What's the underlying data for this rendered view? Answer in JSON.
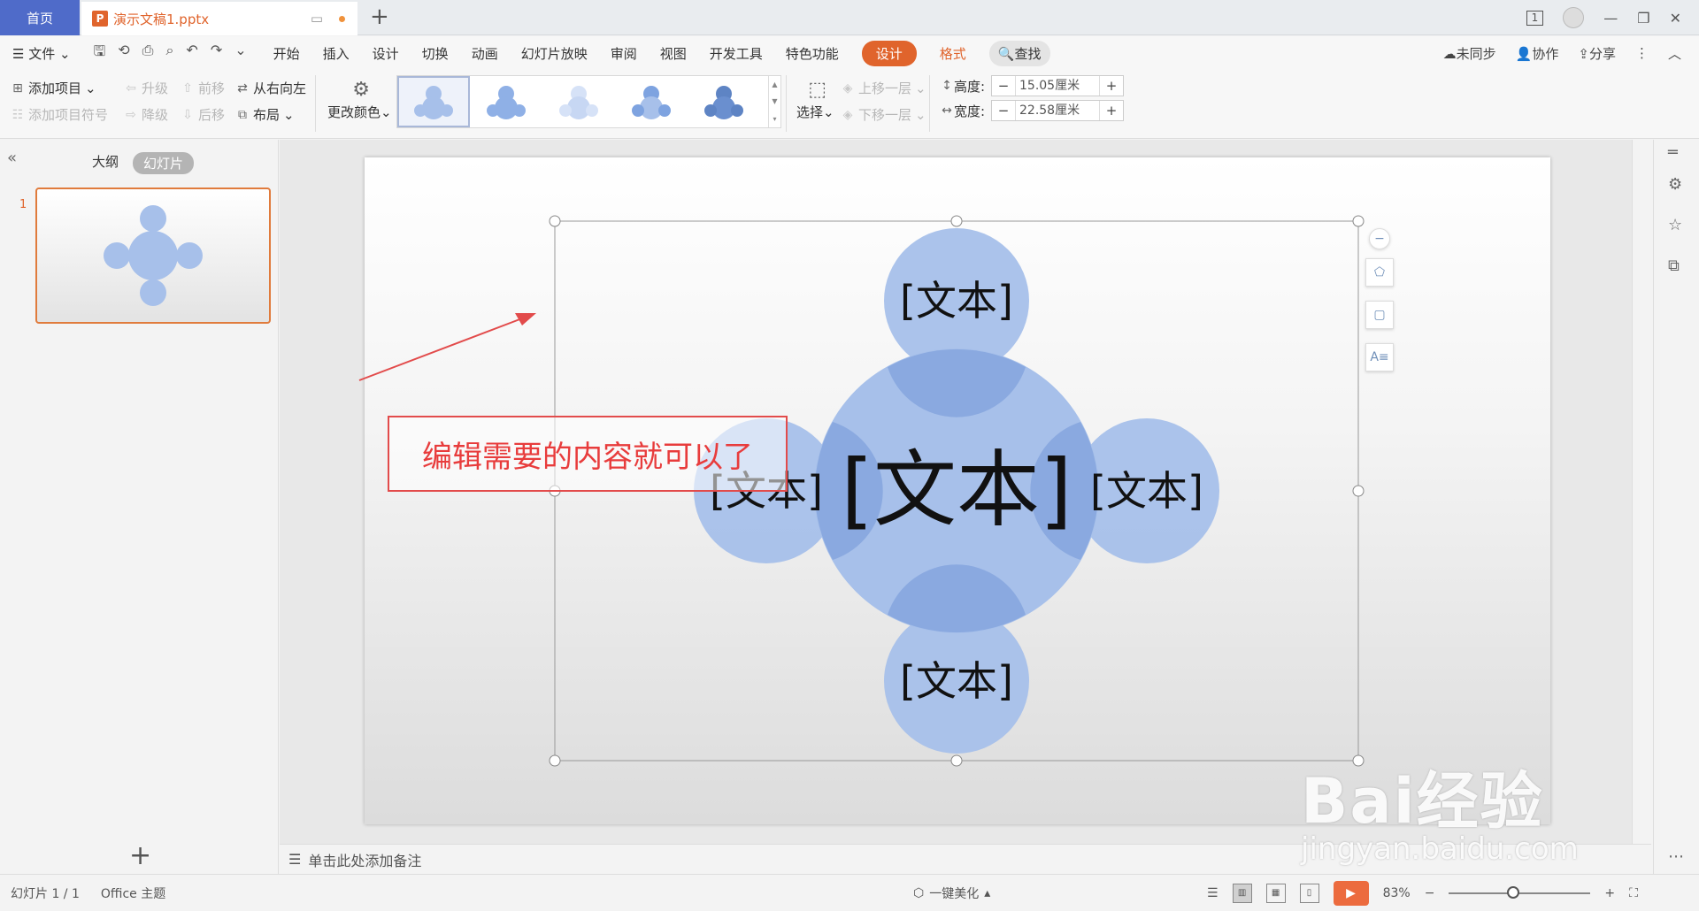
{
  "titlebar": {
    "home_tab": "首页",
    "doc_tab": "演示文稿1.pptx",
    "doc_icon": "P",
    "add_tab": "+",
    "page_indicator": "1"
  },
  "menubar": {
    "file": "文件",
    "items": [
      "开始",
      "插入",
      "设计",
      "切换",
      "动画",
      "幻灯片放映",
      "审阅",
      "视图",
      "开发工具",
      "特色功能"
    ],
    "design_active": "设计",
    "format": "格式",
    "search": "查找",
    "sync": "未同步",
    "collab": "协作",
    "share": "分享"
  },
  "ribbon": {
    "add_item": "添加项目",
    "add_bullet": "添加项目符号",
    "promote": "升级",
    "demote": "降级",
    "move_up": "前移",
    "move_down": "后移",
    "right_to_left": "从右向左",
    "layout": "布局",
    "change_colors": "更改颜色",
    "select": "选择",
    "bring_forward": "上移一层",
    "send_backward": "下移一层",
    "height_label": "高度:",
    "height_value": "15.05厘米",
    "width_label": "宽度:",
    "width_value": "22.58厘米"
  },
  "leftpanel": {
    "outline_tab": "大纲",
    "slides_tab": "幻灯片",
    "slide_number": "1",
    "add_slide": "+"
  },
  "smartart": {
    "center_text": "[文本]",
    "top_text": "[文本]",
    "left_text": "[文本]",
    "right_text": "[文本]",
    "bottom_text": "[文本]",
    "fill_color": "#a7c0ea",
    "overlap_color": "#8aa9e0"
  },
  "annotation": {
    "text": "编辑需要的内容就可以了",
    "color": "#e83c3c"
  },
  "notes": {
    "placeholder": "单击此处添加备注"
  },
  "statusbar": {
    "slide_info": "幻灯片 1 / 1",
    "theme": "Office 主题",
    "beautify": "一键美化",
    "zoom": "83%"
  },
  "watermark": {
    "brand": "Bai经验",
    "url": "jingyan.baidu.com"
  },
  "colors": {
    "accent": "#e0642c",
    "home_tab": "#4f6bc9"
  }
}
